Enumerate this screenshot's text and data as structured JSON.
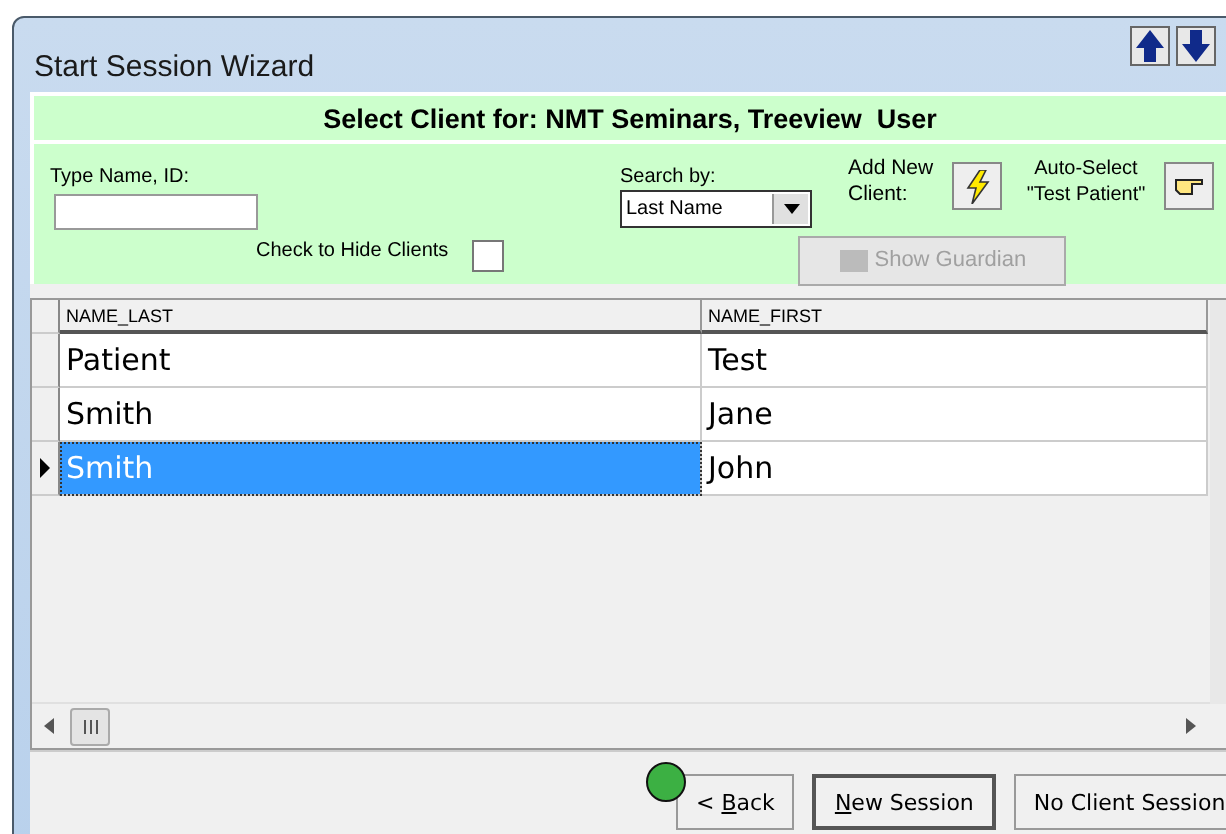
{
  "window": {
    "title": "Start Session Wizard"
  },
  "header": {
    "title": "Select Client for: NMT Seminars, Treeview  User"
  },
  "search": {
    "label": "Type Name, ID:"
  },
  "search_by": {
    "label": "Search by:",
    "value": "Last Name"
  },
  "add_new": {
    "label": "Add New Client:"
  },
  "auto_select": {
    "label": "Auto-Select \"Test Patient\""
  },
  "hide_clients": {
    "label": "Check to Hide Clients",
    "checked": false
  },
  "show_guardian": {
    "label": "Show Guardian",
    "disabled": true
  },
  "table": {
    "columns": [
      "NAME_LAST",
      "NAME_FIRST"
    ],
    "rows": [
      {
        "cells": [
          "Patient",
          "Test"
        ],
        "selected": false
      },
      {
        "cells": [
          "Smith",
          "Jane"
        ],
        "selected": false
      },
      {
        "cells": [
          "Smith",
          "John"
        ],
        "selected": true
      }
    ]
  },
  "buttons": [
    {
      "prefix": "< ",
      "access_key": "B",
      "rest": "ack",
      "default": false
    },
    {
      "access_key": "N",
      "rest": "ew Session",
      "default": true
    },
    {
      "rest": "No Client Session",
      "default": false
    }
  ]
}
